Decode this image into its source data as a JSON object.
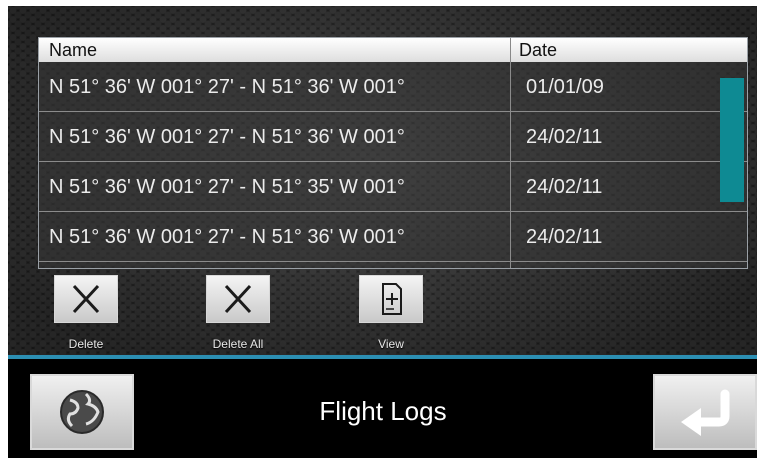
{
  "table": {
    "headers": {
      "name": "Name",
      "date": "Date"
    },
    "rows": [
      {
        "name": "N 51° 36' W 001° 27' - N 51° 36' W 001°",
        "date": "01/01/09"
      },
      {
        "name": "N 51° 36' W 001° 27' - N 51° 36' W 001°",
        "date": "24/02/11"
      },
      {
        "name": "N 51° 36' W 001° 27' - N 51° 35' W 001°",
        "date": "24/02/11"
      },
      {
        "name": "N 51° 36' W 001° 27' - N 51° 36' W 001°",
        "date": "24/02/11"
      }
    ]
  },
  "actions": {
    "delete": {
      "label": "Delete",
      "icon": "close-icon"
    },
    "delete_all": {
      "label": "Delete All",
      "icon": "close-icon"
    },
    "view": {
      "label": "View",
      "icon": "document-plus-icon"
    }
  },
  "footer": {
    "title": "Flight Logs",
    "left_icon": "globe-icon",
    "right_icon": "return-arrow-icon"
  },
  "colors": {
    "accent": "#2c8fb3",
    "scrollbar": "#0e8a93"
  }
}
